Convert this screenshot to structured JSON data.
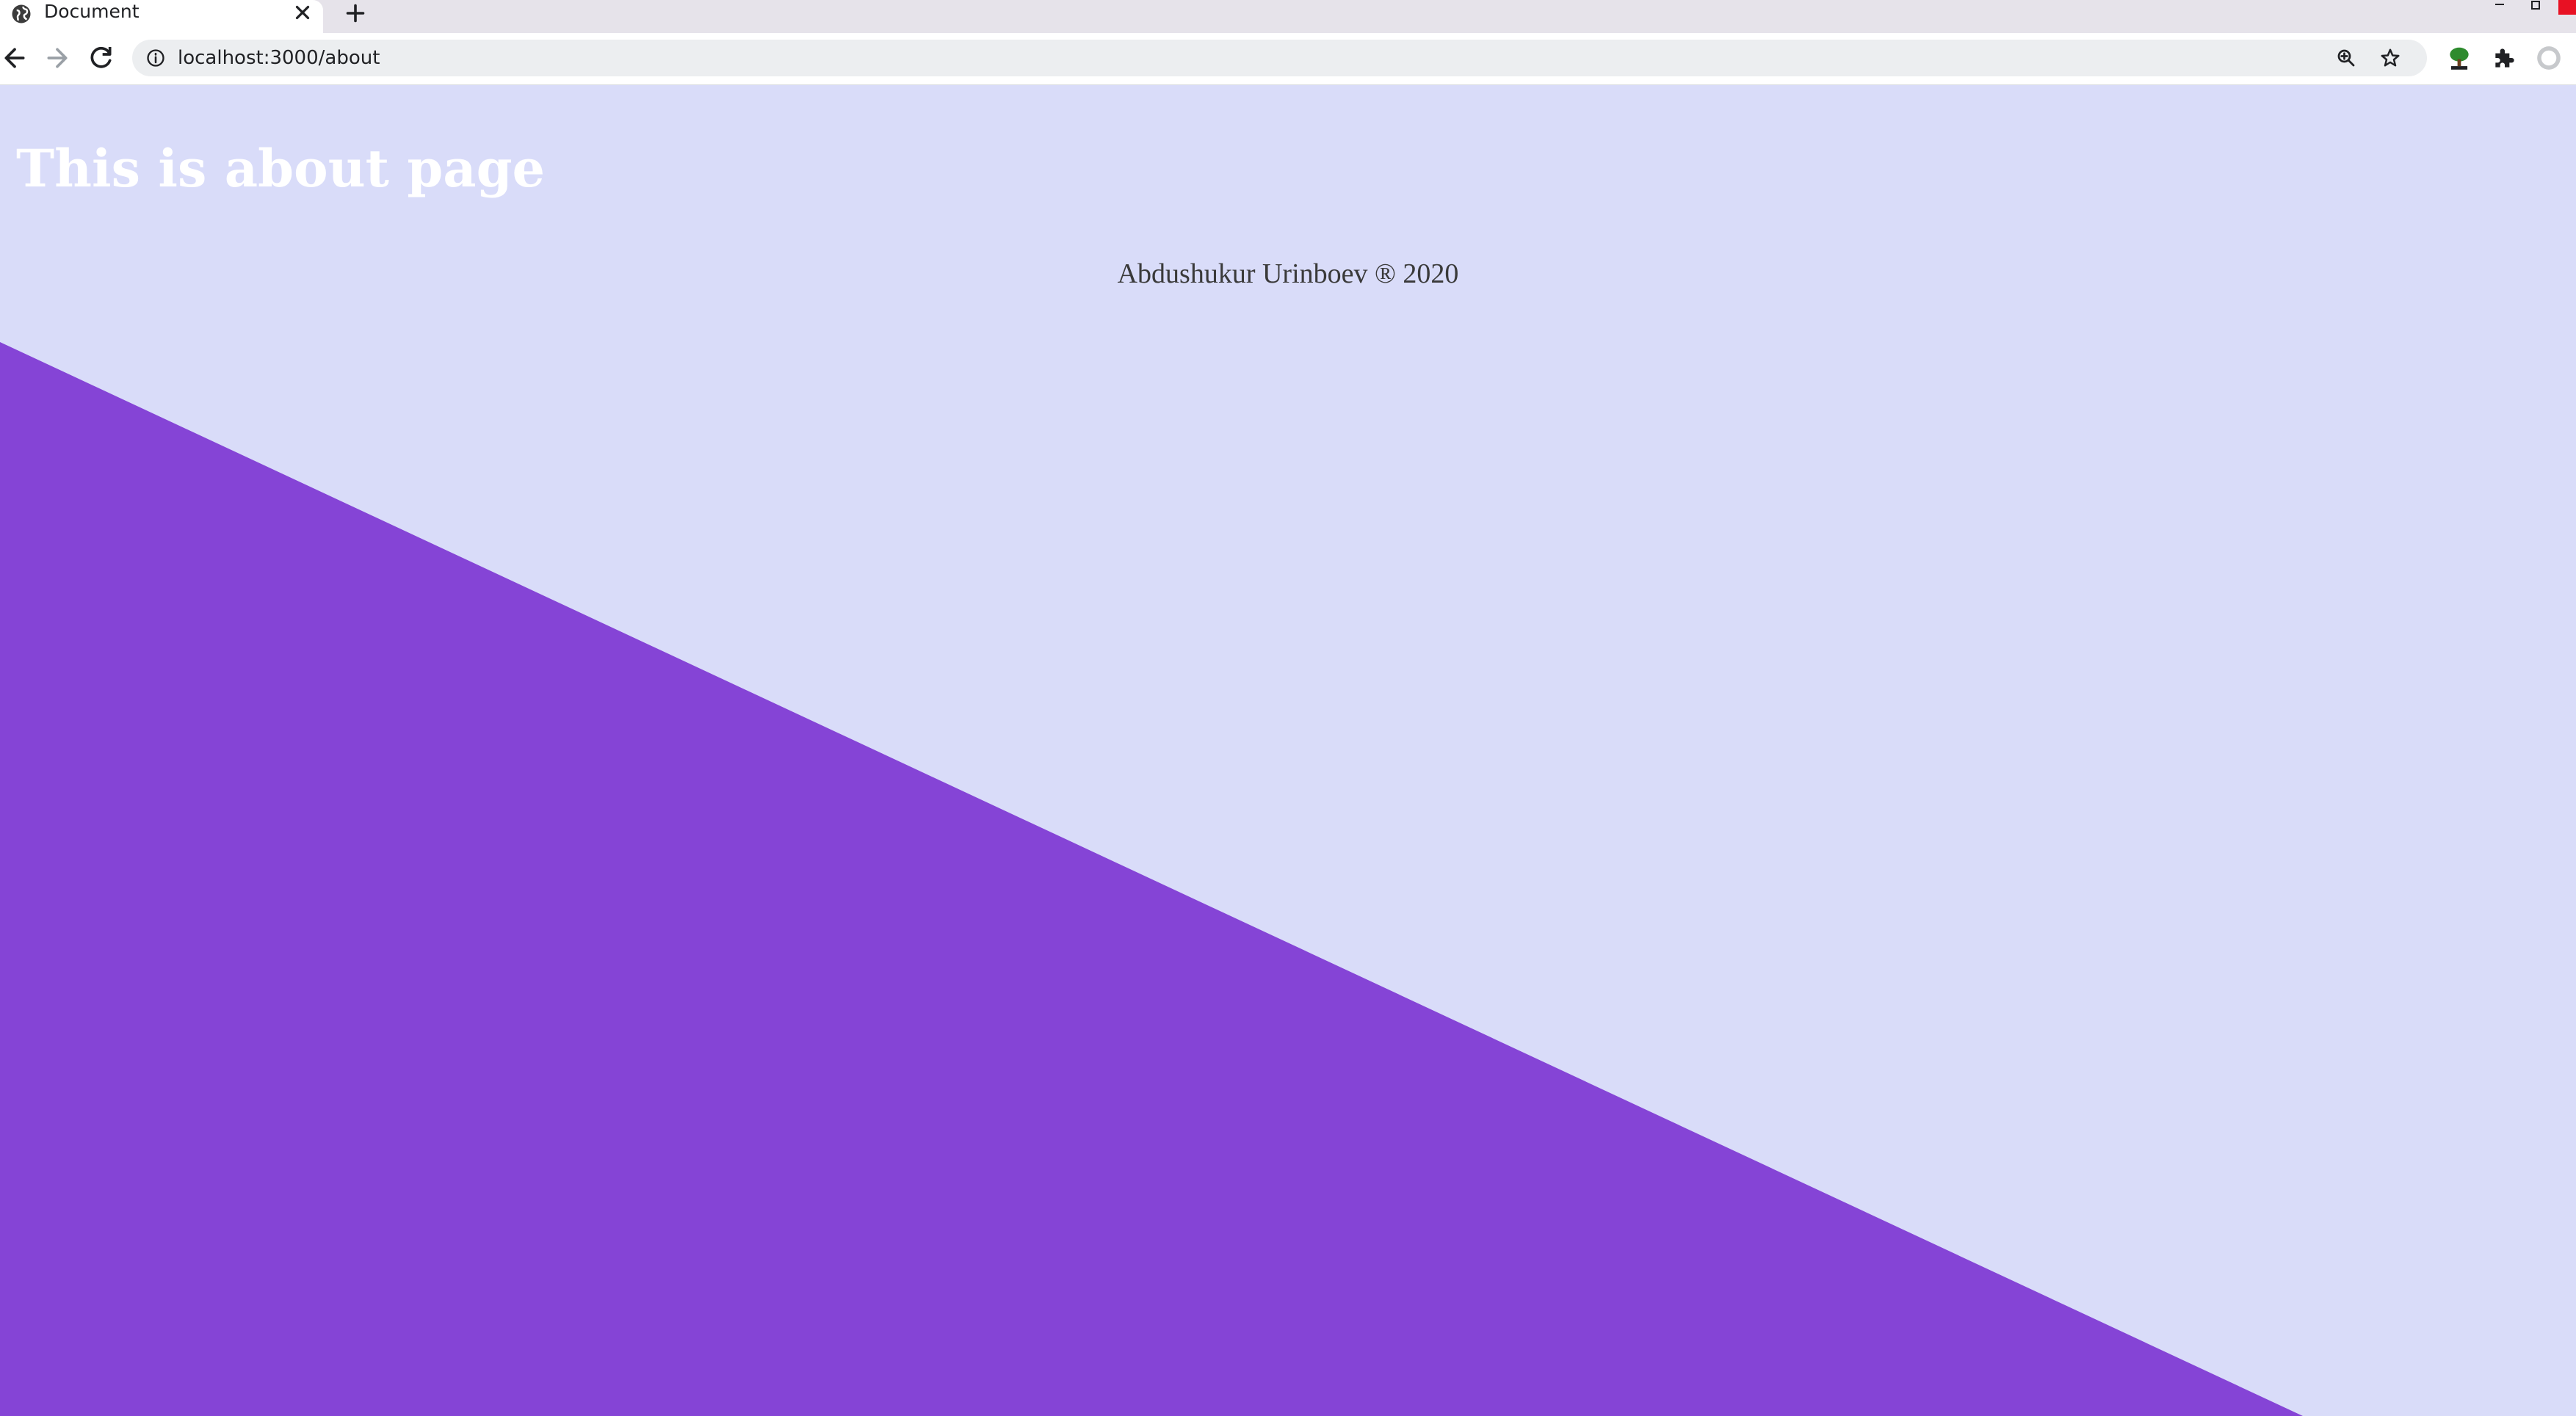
{
  "browser": {
    "tab": {
      "title": "Document"
    },
    "address_bar": {
      "url": "localhost:3000/about"
    },
    "icons": {
      "favicon": "globe-icon",
      "close": "close-icon",
      "new_tab": "plus-icon",
      "back": "back-arrow-icon",
      "forward": "forward-arrow-icon",
      "reload": "reload-icon",
      "site_info": "info-icon",
      "zoom": "zoom-icon",
      "bookmark": "star-icon",
      "extension_tree": "tree-extension-icon",
      "extensions": "puzzle-icon",
      "profile": "profile-avatar-icon"
    }
  },
  "page": {
    "heading": "This is about page",
    "footer": "Abdushukur Urinboev ® 2020",
    "colors": {
      "background": "#d9dcf9",
      "accent_triangle": "#8544d6",
      "heading": "#ffffff",
      "footer_text": "#3a3a3a"
    }
  }
}
